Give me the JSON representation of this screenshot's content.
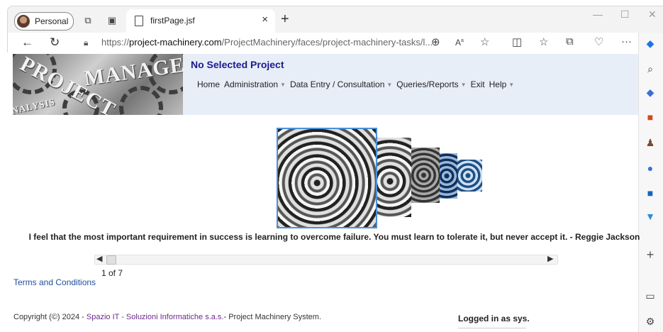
{
  "browser": {
    "profile_label": "Personal",
    "tab_title": "firstPage.jsf",
    "url_prefix": "https://",
    "url_domain": "project-machinery.com",
    "url_path": "/ProjectMachinery/faces/project-machinery-tasks/l..."
  },
  "banner": {
    "words": [
      "PROJECT",
      "MANAGEMENT",
      "NALYSIS"
    ]
  },
  "header": {
    "project_title": "No Selected Project",
    "menu": [
      {
        "label": "Home",
        "has_caret": false
      },
      {
        "label": "Administration",
        "has_caret": true
      },
      {
        "label": "Data Entry / Consultation",
        "has_caret": true
      },
      {
        "label": "Queries/Reports",
        "has_caret": true
      },
      {
        "label": "Exit",
        "has_caret": false
      },
      {
        "label": "Help",
        "has_caret": true
      }
    ]
  },
  "carousel": {
    "quote": "I feel that the most important requirement in success is learning to overcome failure. You must learn to tolerate it, but never accept it. - Reggie Jackson",
    "pager": "1 of 7",
    "current": 1,
    "total": 7
  },
  "footer": {
    "terms_label": "Terms and Conditions",
    "copyright_prefix": "Copyright (©) 2024 - ",
    "company_link": "Spazio IT - Soluzioni Informatiche s.a.s.",
    "copyright_suffix": "- Project Machinery System.",
    "logged_in": "Logged in as sys."
  },
  "colors": {
    "header_bg": "#e8eef8",
    "title_color": "#1a1a8e",
    "link_color": "#1f4e9a",
    "company_link_color": "#6b2a8a"
  }
}
